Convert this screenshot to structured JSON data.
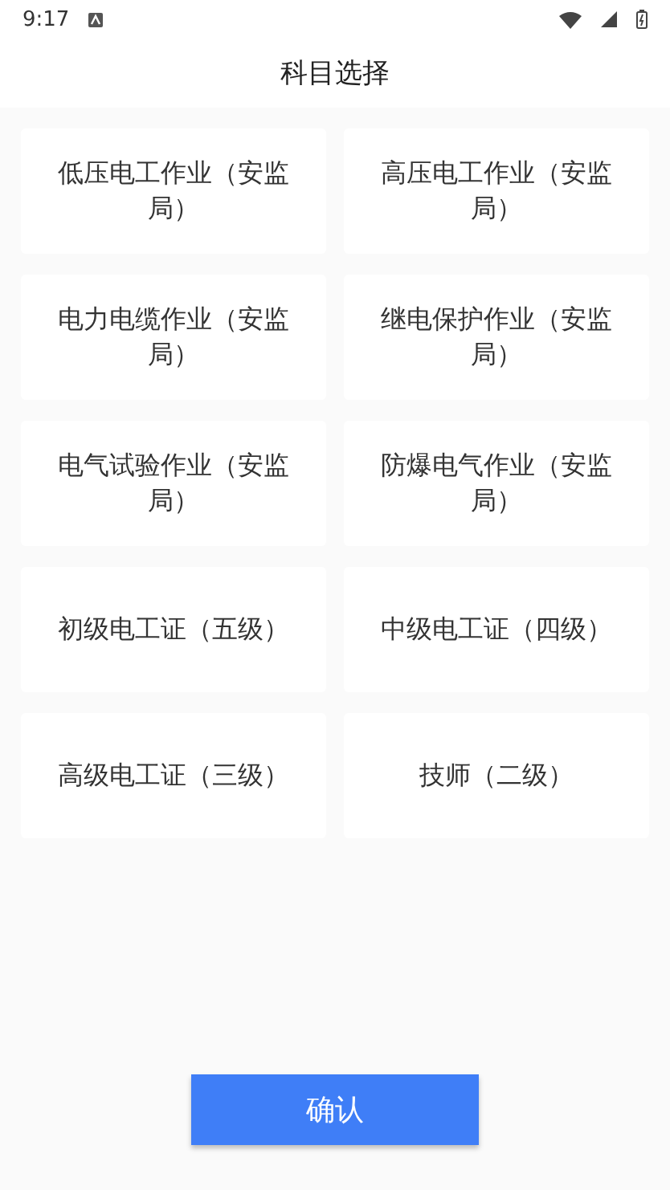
{
  "status_bar": {
    "time": "9:17"
  },
  "header": {
    "title": "科目选择"
  },
  "subjects": [
    {
      "label": "低压电工作业（安监局）"
    },
    {
      "label": "高压电工作业（安监局）"
    },
    {
      "label": "电力电缆作业（安监局）"
    },
    {
      "label": "继电保护作业（安监局）"
    },
    {
      "label": "电气试验作业（安监局）"
    },
    {
      "label": "防爆电气作业（安监局）"
    },
    {
      "label": "初级电工证（五级）"
    },
    {
      "label": "中级电工证（四级）"
    },
    {
      "label": "高级电工证（三级）"
    },
    {
      "label": "技师（二级）"
    }
  ],
  "confirm_button": "确认"
}
